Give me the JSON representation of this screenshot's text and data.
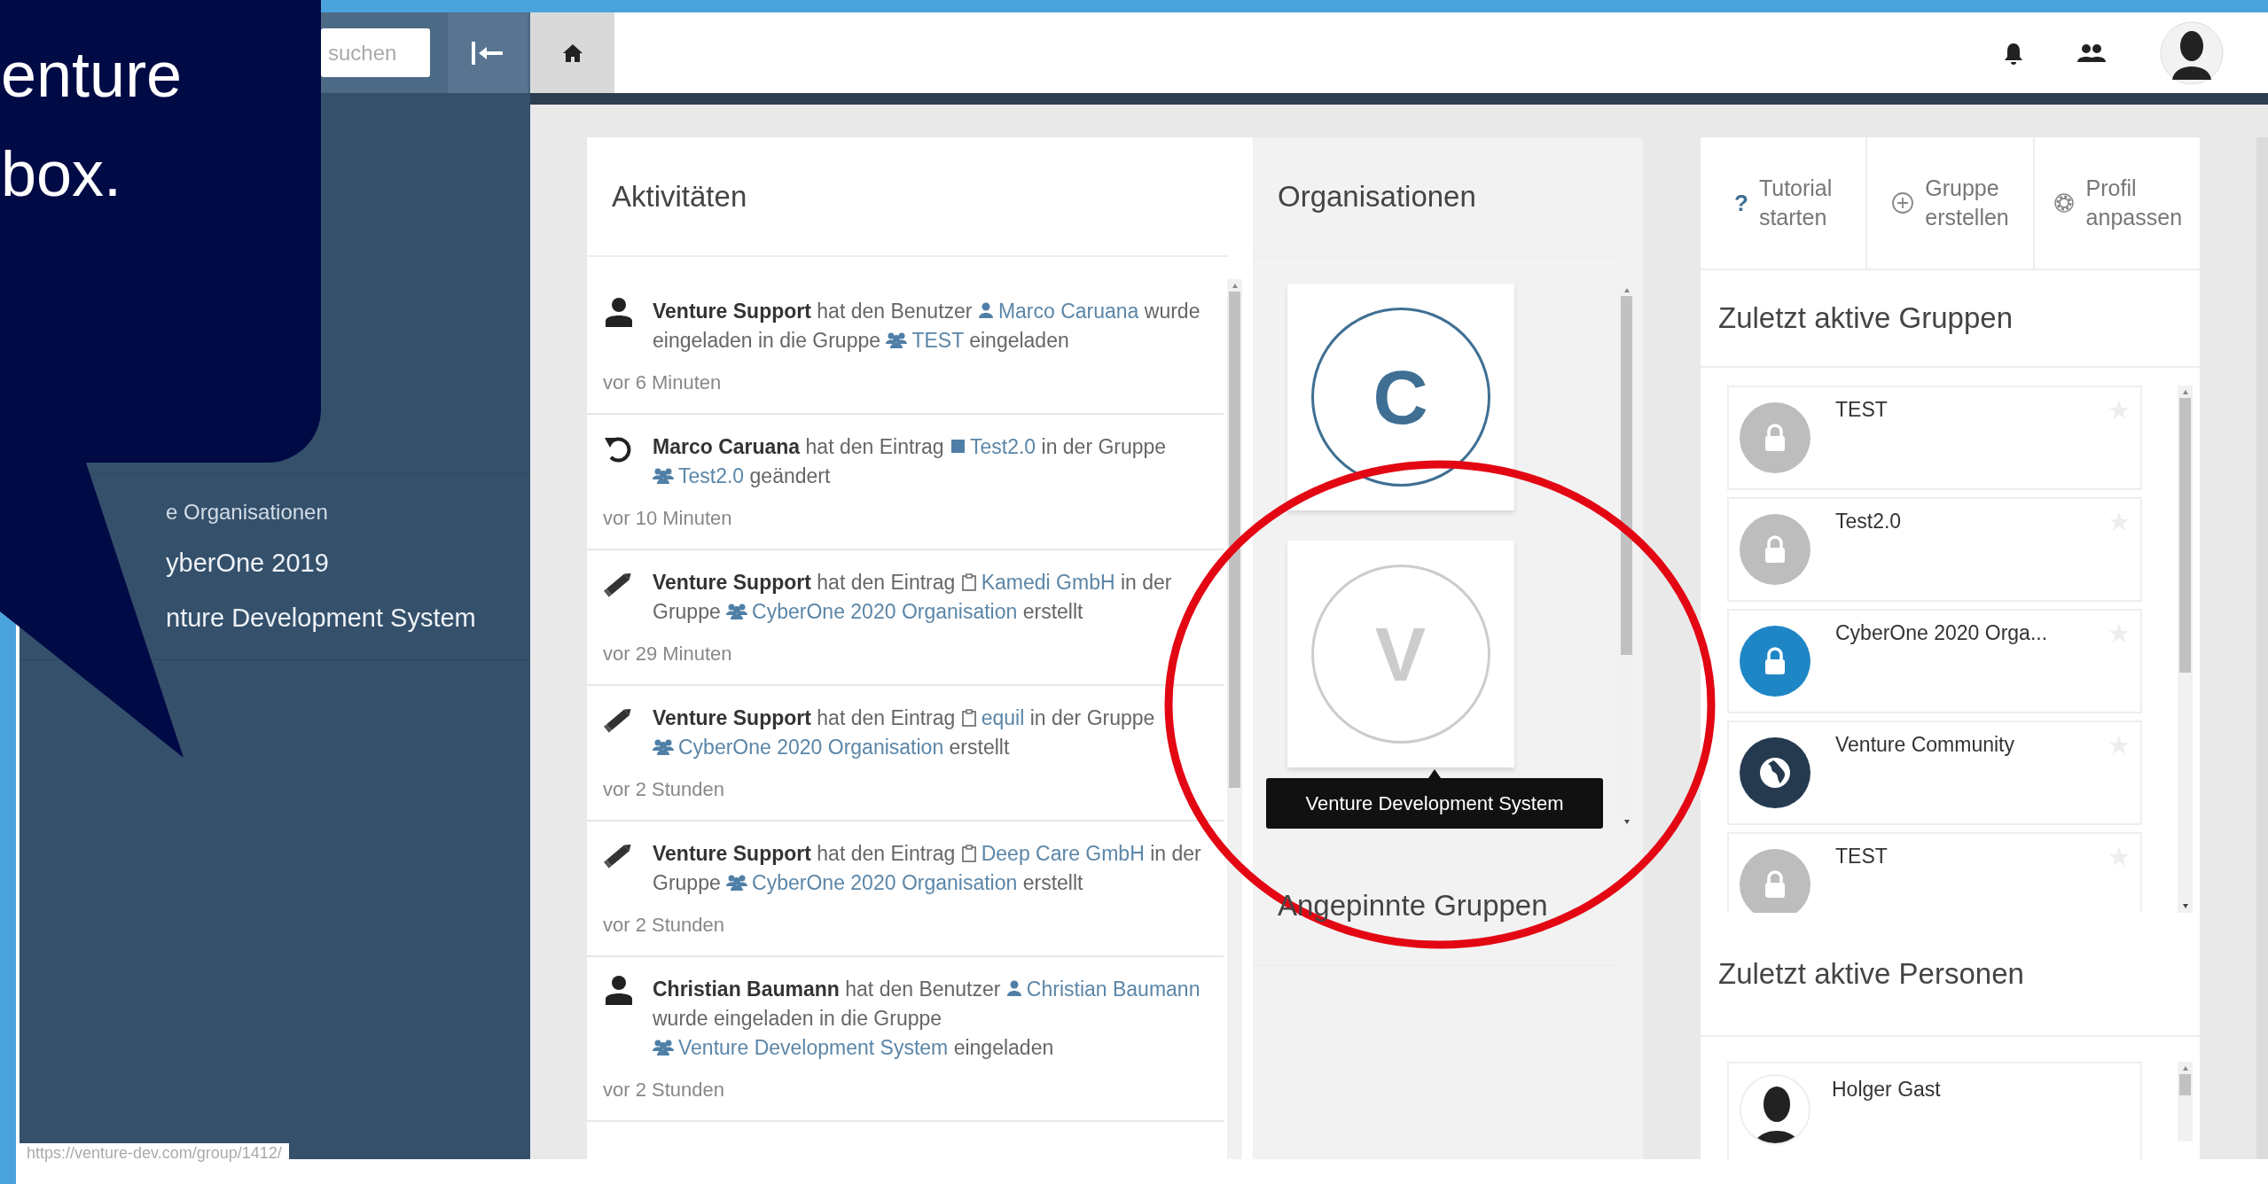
{
  "callout": {
    "lines": [
      "enture",
      "box."
    ]
  },
  "sidebar": {
    "search": {
      "placeholder": "suchen"
    },
    "items": [
      {
        "label": "e Organisationen",
        "kind": "heading"
      },
      {
        "label": "yberOne 2019",
        "kind": "link"
      },
      {
        "label": "nture Development System",
        "kind": "link"
      }
    ]
  },
  "activities": {
    "title": "Aktivitäten",
    "items": [
      {
        "kind": "invite",
        "time": "vor 6 Minuten",
        "segments": [
          {
            "kind": "actor",
            "text": "Venture Support"
          },
          {
            "kind": "plain",
            "text": " hat den Benutzer "
          },
          {
            "kind": "user_link",
            "text": "Marco Caruana"
          },
          {
            "kind": "plain",
            "text": " wurde eingeladen in die Gruppe "
          },
          {
            "kind": "group_link",
            "text": "TEST"
          },
          {
            "kind": "plain",
            "text": " eingeladen"
          }
        ]
      },
      {
        "kind": "undo",
        "time": "vor 10 Minuten",
        "segments": [
          {
            "kind": "actor",
            "text": "Marco Caruana"
          },
          {
            "kind": "plain",
            "text": " hat den Eintrag "
          },
          {
            "kind": "entry_link",
            "text": "Test2.0"
          },
          {
            "kind": "plain",
            "text": " in der Gruppe "
          },
          {
            "kind": "group_link",
            "text": "Test2.0"
          },
          {
            "kind": "plain",
            "text": " geändert"
          }
        ]
      },
      {
        "kind": "edit",
        "time": "vor 29 Minuten",
        "segments": [
          {
            "kind": "actor",
            "text": "Venture Support"
          },
          {
            "kind": "plain",
            "text": " hat den Eintrag "
          },
          {
            "kind": "doc_link",
            "text": "Kamedi GmbH"
          },
          {
            "kind": "plain",
            "text": " in der Gruppe "
          },
          {
            "kind": "group_link",
            "text": "CyberOne 2020 Organisation"
          },
          {
            "kind": "plain",
            "text": " erstellt"
          }
        ]
      },
      {
        "kind": "edit",
        "time": "vor 2 Stunden",
        "segments": [
          {
            "kind": "actor",
            "text": "Venture Support"
          },
          {
            "kind": "plain",
            "text": " hat den Eintrag "
          },
          {
            "kind": "doc_link",
            "text": "equil"
          },
          {
            "kind": "plain",
            "text": " in der Gruppe "
          },
          {
            "kind": "group_link",
            "text": "CyberOne 2020 Organisation"
          },
          {
            "kind": "plain",
            "text": " erstellt"
          }
        ]
      },
      {
        "kind": "edit",
        "time": "vor 2 Stunden",
        "segments": [
          {
            "kind": "actor",
            "text": "Venture Support"
          },
          {
            "kind": "plain",
            "text": " hat den Eintrag "
          },
          {
            "kind": "doc_link",
            "text": "Deep Care GmbH"
          },
          {
            "kind": "plain",
            "text": " in der Gruppe "
          },
          {
            "kind": "group_link",
            "text": "CyberOne 2020 Organisation"
          },
          {
            "kind": "plain",
            "text": " erstellt"
          }
        ]
      },
      {
        "kind": "invite",
        "time": "vor 2 Stunden",
        "segments": [
          {
            "kind": "actor",
            "text": "Christian Baumann"
          },
          {
            "kind": "plain",
            "text": " hat den Benutzer "
          },
          {
            "kind": "user_link",
            "text": "Christian Baumann"
          },
          {
            "kind": "plain",
            "text": " wurde eingeladen in die Gruppe "
          },
          {
            "kind": "group_link",
            "text": "Venture Development System"
          },
          {
            "kind": "plain",
            "text": " eingeladen"
          }
        ]
      }
    ]
  },
  "organisations": {
    "title": "Organisationen",
    "orgs": [
      {
        "letter": "C",
        "color": "#3f6f93"
      },
      {
        "letter": "V",
        "color": "#cccccc"
      }
    ],
    "tooltip": "Venture Development System",
    "pinned_title": "Angepinnte Gruppen"
  },
  "actions": [
    {
      "kind": "tutorial",
      "glyph": "?",
      "label": "Tutorial starten"
    },
    {
      "kind": "create",
      "label": "Gruppe erstellen"
    },
    {
      "kind": "settings",
      "label": "Profil anpassen"
    }
  ],
  "recent_groups": {
    "title": "Zuletzt aktive Gruppen",
    "items": [
      {
        "name": "TEST",
        "kind": "private",
        "starred": false
      },
      {
        "name": "Test2.0",
        "kind": "private",
        "starred": false
      },
      {
        "name": "CyberOne 2020 Orga...",
        "kind": "organisation",
        "starred": false
      },
      {
        "name": "Venture Community",
        "kind": "public",
        "starred": false
      },
      {
        "name": "TEST",
        "kind": "private",
        "starred": false
      }
    ]
  },
  "recent_people": {
    "title": "Zuletzt aktive Personen",
    "items": [
      {
        "name": "Holger Gast"
      }
    ]
  },
  "status_url": "https://venture-dev.com/group/1412/"
}
